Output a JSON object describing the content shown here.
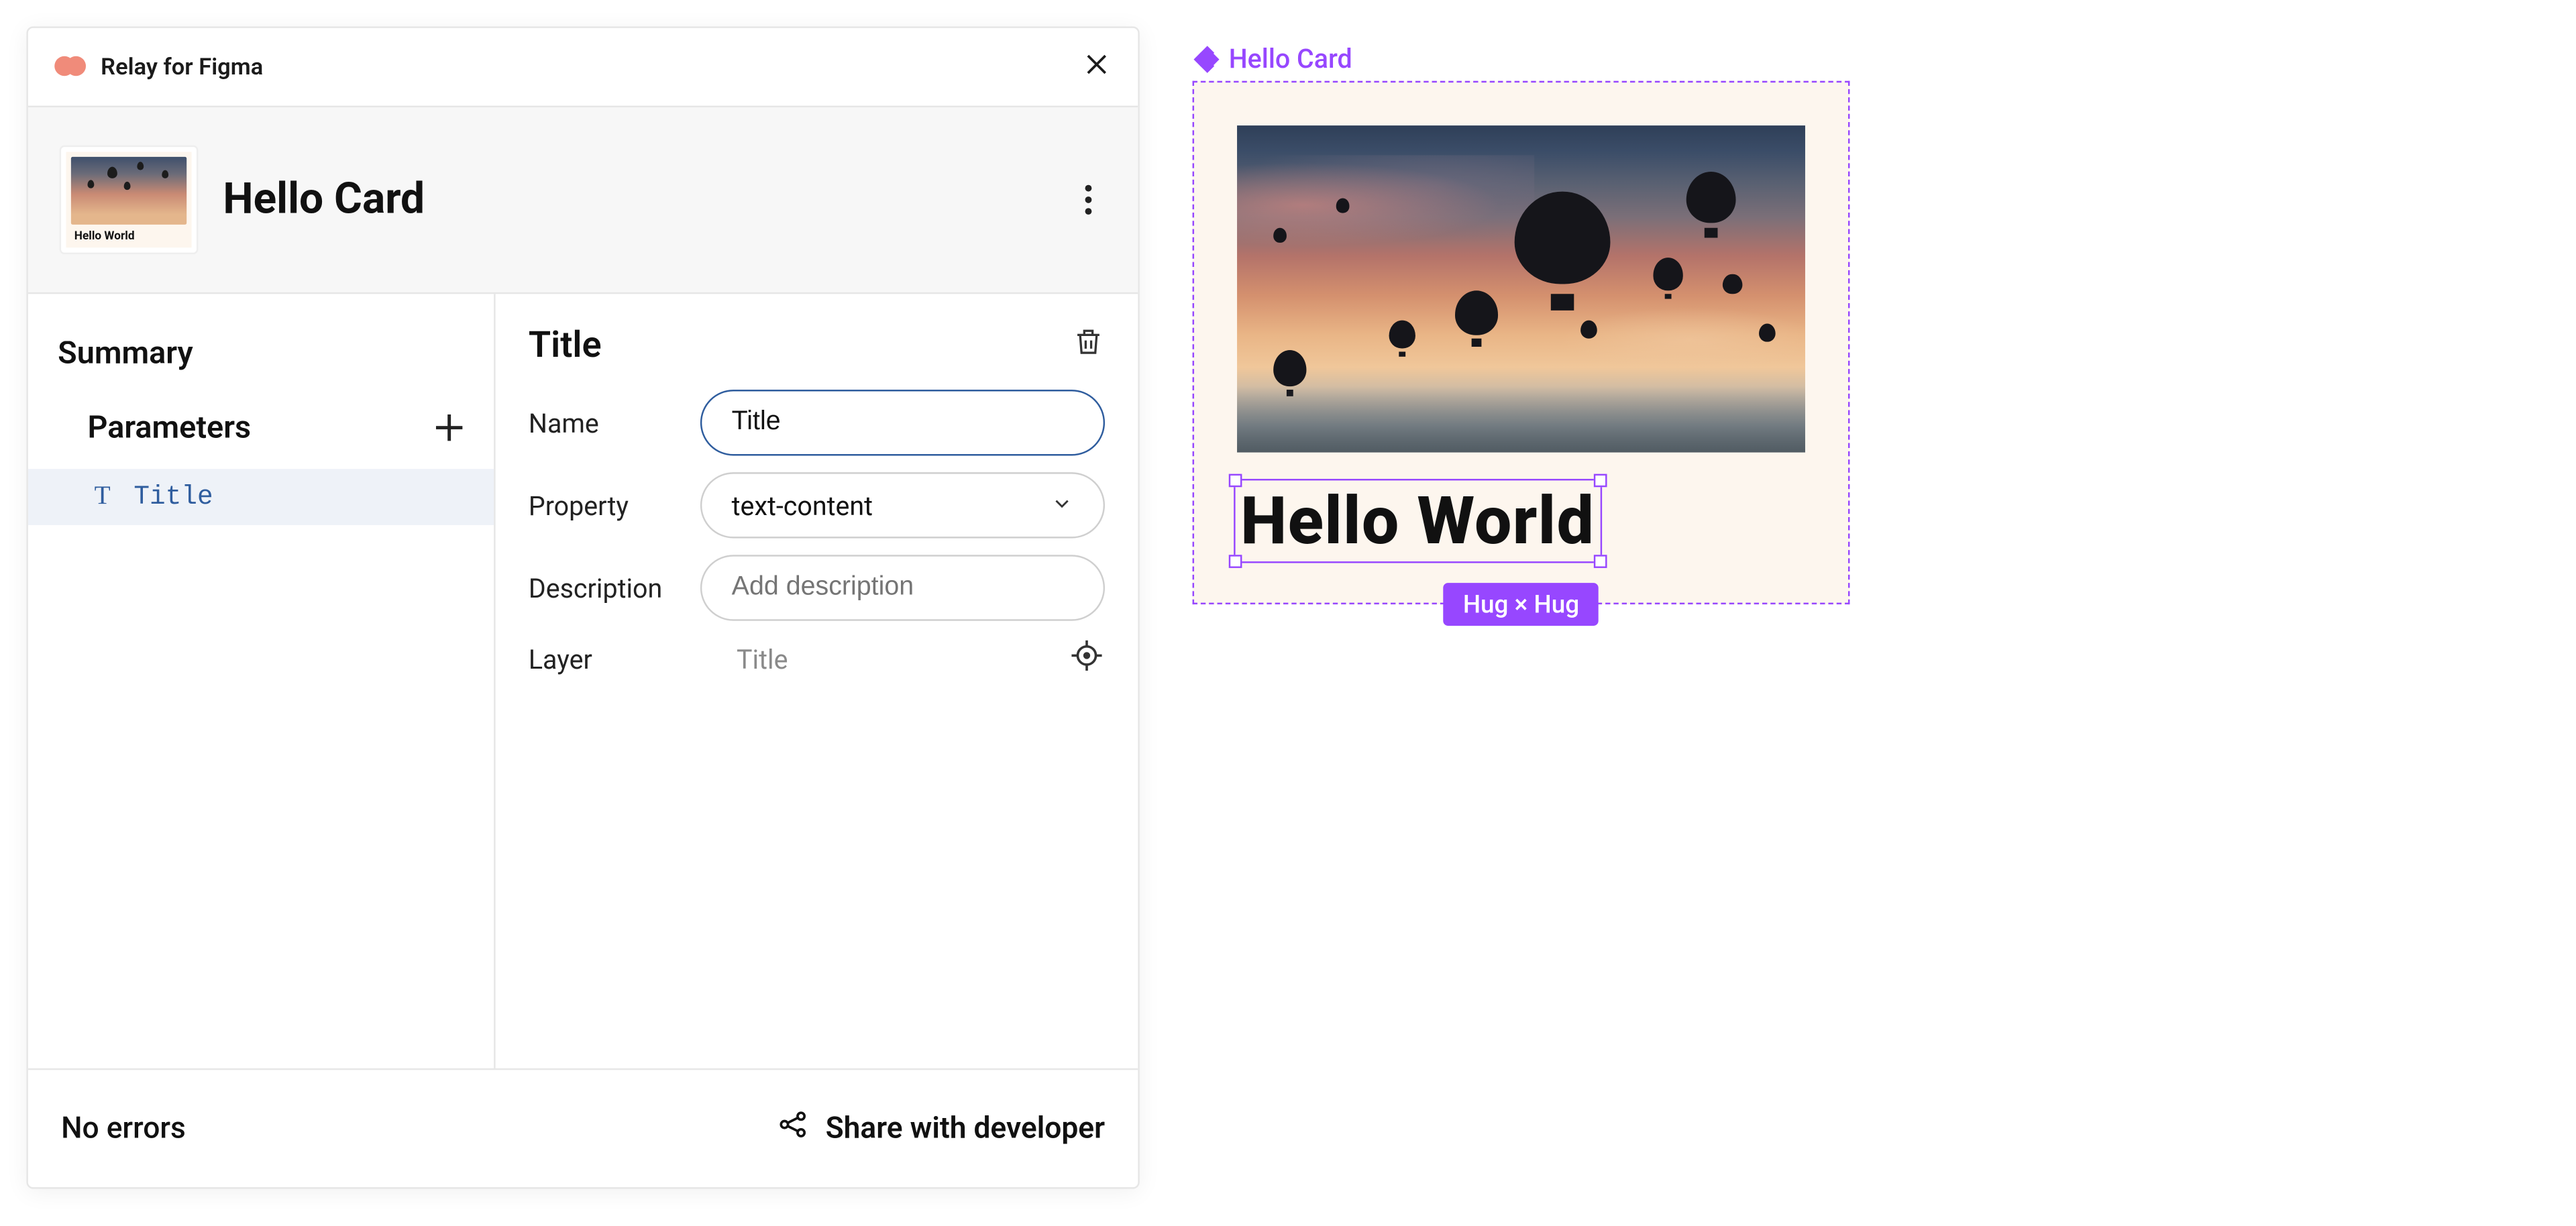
{
  "plugin": {
    "brand": "Relay for Figma",
    "component_name": "Hello Card",
    "thumb_caption": "Hello World"
  },
  "sidebar": {
    "section_summary": "Summary",
    "section_parameters": "Parameters",
    "items": [
      {
        "icon": "T",
        "label": "Title"
      }
    ]
  },
  "detail": {
    "heading": "Title",
    "name_label": "Name",
    "name_value": "Title",
    "property_label": "Property",
    "property_value": "text-content",
    "description_label": "Description",
    "description_placeholder": "Add description",
    "layer_label": "Layer",
    "layer_value": "Title"
  },
  "footer": {
    "status": "No errors",
    "share_label": "Share with developer"
  },
  "canvas": {
    "frame_label": "Hello Card",
    "card_title": "Hello World",
    "resize_badge": "Hug × Hug"
  }
}
